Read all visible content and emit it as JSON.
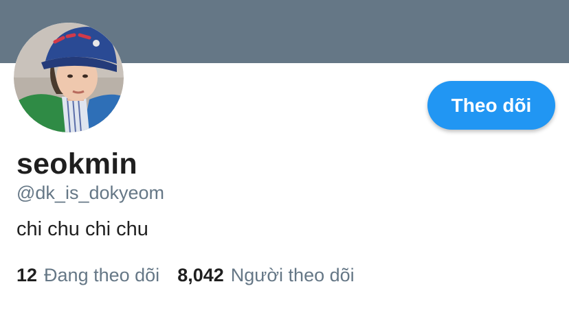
{
  "colors": {
    "banner": "#657786",
    "accent": "#2196f3",
    "text_primary": "#1f1f1f",
    "text_secondary": "#657786"
  },
  "profile": {
    "display_name": "seokmin",
    "handle": "@dk_is_dokyeom",
    "bio": "chi chu chi chu",
    "avatar_icon": "profile-photo"
  },
  "actions": {
    "follow_label": "Theo dõi"
  },
  "stats": {
    "following_count": "12",
    "following_label": "Đang theo dõi",
    "followers_count": "8,042",
    "followers_label": "Người theo dõi"
  }
}
